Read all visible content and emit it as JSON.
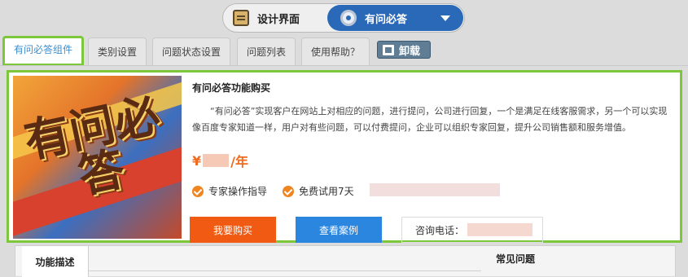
{
  "switcher": {
    "design": "设计界面",
    "app": "有问必答"
  },
  "tabs": [
    "有问必答组件",
    "类别设置",
    "问题状态设置",
    "问题列表",
    "使用帮助？"
  ],
  "unload": "卸载",
  "card": {
    "hero_text": "有问必答",
    "title": "有问必答功能购买",
    "description": "“有问必答”实现客户在网站上对相应的问题，进行提问，公司进行回复，一个是满足在线客服需求，另一个可以实现像百度专家知道一样，用户对有些问题，可以付费提问，企业可以组织专家回复，提升公司销售额和服务增值。",
    "price_prefix": "¥",
    "price_suffix": "/年",
    "features": [
      "专家操作指导",
      "免费试用7天"
    ],
    "buy_button": "我要购买",
    "case_button": "查看案例",
    "phone_label": "咨询电话："
  },
  "bottom": {
    "tab": "功能描述",
    "faq": "常见问题"
  },
  "colors": {
    "accent_green": "#7cc83a",
    "orange": "#f05a12",
    "blue": "#2b86e0"
  }
}
